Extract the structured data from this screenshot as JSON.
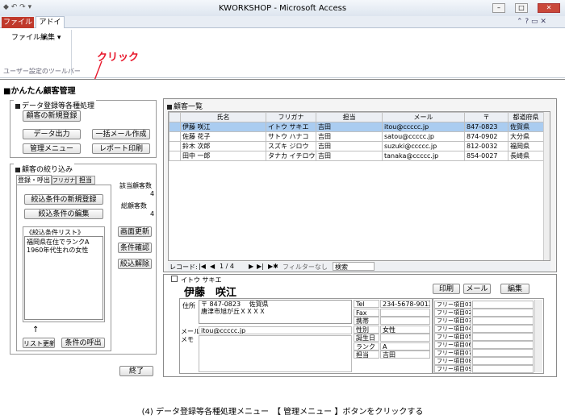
{
  "titlebar": {
    "title": "KWORKSHOP - Microsoft Access",
    "quick_access": "◆ ↶ ↷ ▾"
  },
  "ribbon": {
    "tabs": [
      "ファイル",
      "アドイン"
    ],
    "menus": [
      "ファイル ▾",
      "編集 ▾"
    ],
    "toolbar_label": "ユーザー設定のツールバー"
  },
  "annotation": {
    "text": "クリック"
  },
  "app": {
    "title": "■かんたん顧客管理"
  },
  "left": {
    "group1_title": "データ登録等各種処理",
    "buttons": {
      "new_customer": "顧客の新規登録",
      "data_output": "データ出力",
      "bulk_mail": "一括メール作成",
      "admin_menu": "管理メニュー",
      "report_print": "レポート印刷"
    },
    "group2_title": "顧客の絞り込み",
    "tabs": [
      "登録・呼出",
      "フリガナ",
      "担当"
    ],
    "filter_new": "絞込条件の新規登録",
    "filter_edit": "絞込条件の編集",
    "list_title": "《絞込条件リスト》",
    "list_items": [
      "福岡県在住でランクA",
      "1960年代生れの女性"
    ],
    "arrow": "↑",
    "list_refresh": "リスト更新",
    "condition_call": "条件の呼出",
    "match_label": "該当顧客数",
    "match_value": "4",
    "total_label": "総顧客数",
    "total_value": "4",
    "screen_update": "画面更新",
    "condition_confirm": "条件確認",
    "filter_clear": "絞込解除",
    "exit": "終了"
  },
  "customer_list": {
    "title": "顧客一覧",
    "headers": [
      "氏名",
      "フリガナ",
      "担当",
      "メール",
      "〒",
      "都道府県"
    ],
    "rows": [
      [
        "伊藤 咲江",
        "イトウ サキエ",
        "吉田",
        "itou@ccccc.jp",
        "847-0823",
        "佐賀県"
      ],
      [
        "佐藤 花子",
        "サトウ ハナコ",
        "吉田",
        "satou@ccccc.jp",
        "874-0902",
        "大分県"
      ],
      [
        "鈴木 次郎",
        "スズキ ジロウ",
        "吉田",
        "suzuki@ccccc.jp",
        "812-0032",
        "福岡県"
      ],
      [
        "田中 一郎",
        "タナカ イチロウ",
        "吉田",
        "tanaka@ccccc.jp",
        "854-0027",
        "長崎県"
      ]
    ]
  },
  "record_nav": {
    "label": "レコード:",
    "first": "|◀",
    "prev": "◀",
    "position": "1 / 4",
    "next": "▶",
    "last": "▶|",
    "new": "▶✱",
    "filter": "フィルターなし",
    "search": "検索"
  },
  "detail": {
    "furigana": "イトウ サキエ",
    "name": "伊藤　咲江",
    "print": "印刷",
    "mail": "メール",
    "edit": "編集",
    "address_label": "住所",
    "address_line1": "〒 847-0823　 佐賀県",
    "address_line2": "唐津市旭が丘ＸＸＸＸ",
    "email_label": "メール",
    "email_value": "itou@ccccc.jp",
    "memo_label": "メモ",
    "tel_label": "Tel",
    "tel_value": "234-5678-9012",
    "fax_label": "Fax",
    "mobile_label": "携帯",
    "gender_label": "性別",
    "gender_value": "女性",
    "birthday_label": "誕生日",
    "rank_label": "ランク",
    "rank_value": "A",
    "staff_label": "担当",
    "staff_value": "吉田",
    "free_items": [
      "フリー項目01",
      "フリー項目02",
      "フリー項目03",
      "フリー項目04",
      "フリー項目05",
      "フリー項目06",
      "フリー項目07",
      "フリー項目08",
      "フリー項目09"
    ]
  },
  "caption": "(4) データ登録等各種処理メニュー　【 管理メニュー 】ボタンをクリックする",
  "colors": {
    "ribbon_tab": "#c0392b",
    "annotation": "#e8182c",
    "selection": "#aaccf0"
  }
}
